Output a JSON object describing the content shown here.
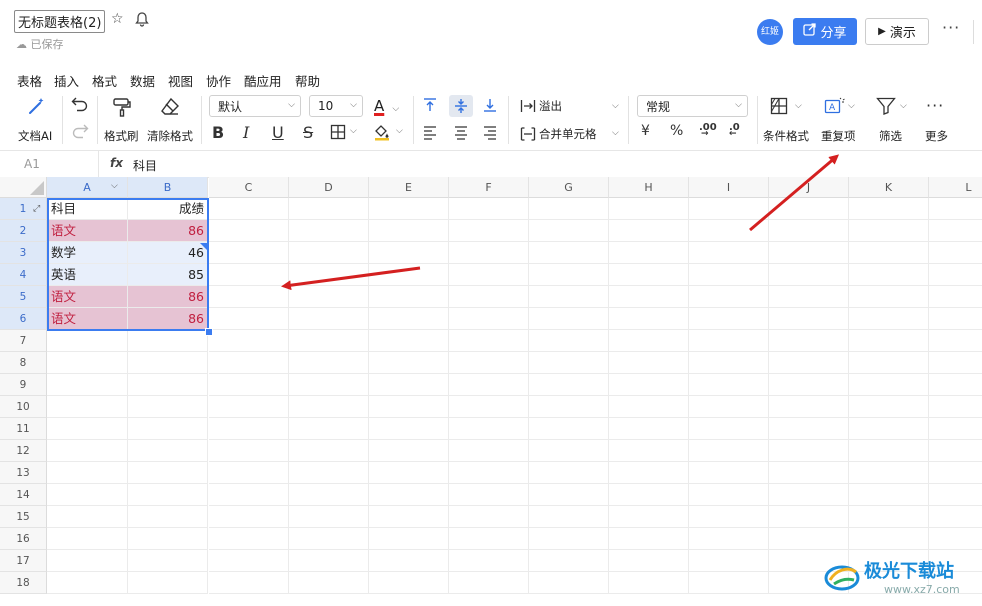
{
  "title": {
    "doc_title": "无标题表格(2)",
    "saved_status": "已保存",
    "avatar_text": "红姬",
    "share_label": "分享",
    "present_label": "演示",
    "more_label": "···"
  },
  "menu": [
    "表格",
    "插入",
    "格式",
    "数据",
    "视图",
    "协作",
    "酷应用",
    "帮助"
  ],
  "toolbar": {
    "doc_ai": "文档AI",
    "format_painter": "格式刷",
    "clear_format": "清除格式",
    "font_name": "默认",
    "font_size": "10",
    "bold": "B",
    "italic": "I",
    "underline": "U",
    "strike": "S",
    "overflow": "溢出",
    "merge": "合并单元格",
    "number_format": "常规",
    "currency": "¥",
    "percent": "%",
    "decimal_add": ".00",
    "decimal_remove": ".0",
    "cond_format": "条件格式",
    "duplicates": "重复项",
    "filter": "筛选",
    "more": "更多"
  },
  "formula_bar": {
    "cell_ref": "A1",
    "fx": "fx",
    "value": "科目"
  },
  "columns": [
    "A",
    "B",
    "C",
    "D",
    "E",
    "F",
    "G",
    "H",
    "I",
    "J",
    "K",
    "L"
  ],
  "rows": [
    "1",
    "2",
    "3",
    "4",
    "5",
    "6",
    "7",
    "8",
    "9",
    "10",
    "11",
    "12",
    "13",
    "14",
    "15",
    "16",
    "17",
    "18"
  ],
  "cells": [
    {
      "a": "科目",
      "b": "成绩",
      "dup": false
    },
    {
      "a": "语文",
      "b": "86",
      "dup": true
    },
    {
      "a": "数学",
      "b": "46",
      "dup": false
    },
    {
      "a": "英语",
      "b": "85",
      "dup": false
    },
    {
      "a": "语文",
      "b": "86",
      "dup": true
    },
    {
      "a": "语文",
      "b": "86",
      "dup": true
    }
  ],
  "watermark": {
    "name": "极光下载站",
    "url": "www.xz7.com"
  },
  "colors": {
    "accent": "#3b7cf0",
    "duplicate_bg": "#e6c3d3",
    "duplicate_text": "#c02040",
    "arrow": "#d42020"
  }
}
